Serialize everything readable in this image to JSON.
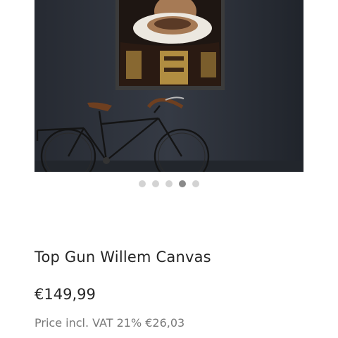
{
  "product": {
    "title": "Top Gun Willem Canvas",
    "price": "€149,99",
    "vat_note": "Price incl. VAT 21% €26,03"
  },
  "gallery": {
    "image_count": 5,
    "active_index": 3
  },
  "colors": {
    "wall": "#2c3038",
    "text": "#262626",
    "muted_text": "#7a7a7a",
    "dot_inactive": "#d3d3d3",
    "dot_active": "#8a8a8a"
  }
}
